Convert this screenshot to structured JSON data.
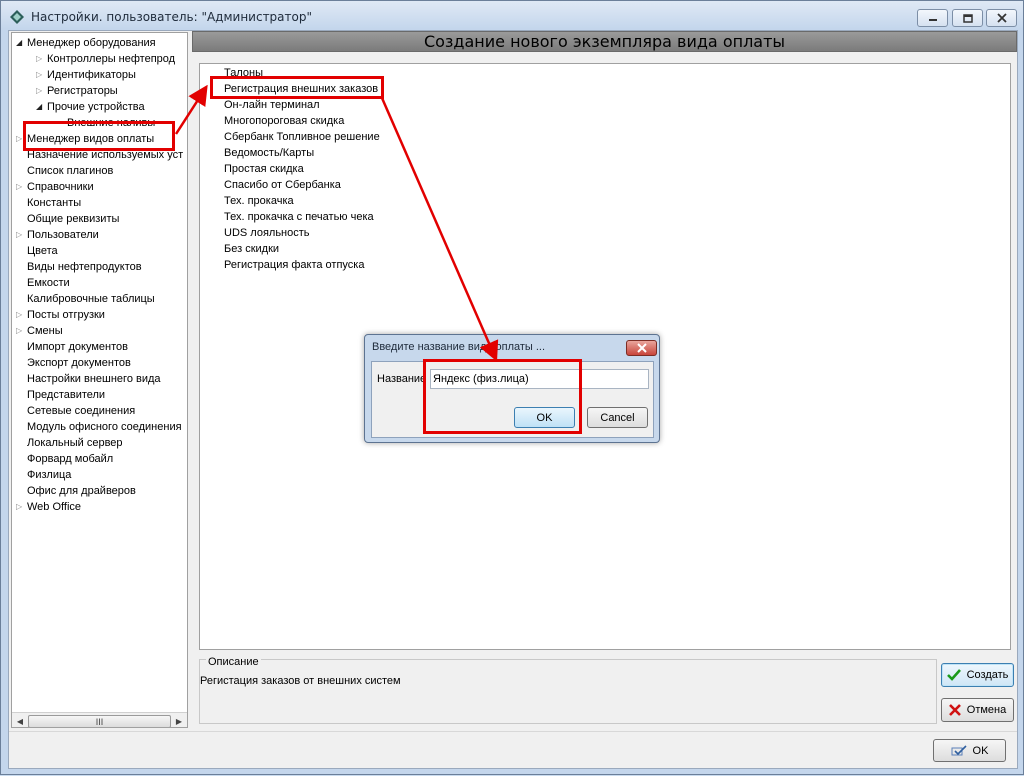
{
  "window": {
    "title": "Настройки. пользователь: \"Администратор\"",
    "accent": "#c4d6ec"
  },
  "tree": {
    "items": [
      {
        "label": "Менеджер оборудования",
        "level": 0,
        "state": "expanded"
      },
      {
        "label": "Контроллеры нефтепрод",
        "level": 1,
        "state": "collapsed"
      },
      {
        "label": "Идентификаторы",
        "level": 1,
        "state": "collapsed"
      },
      {
        "label": "Регистраторы",
        "level": 1,
        "state": "collapsed"
      },
      {
        "label": "Прочие устройства",
        "level": 1,
        "state": "expanded"
      },
      {
        "label": "Внешние наливы",
        "level": 2,
        "state": "leaf"
      },
      {
        "label": "Менеджер видов оплаты",
        "level": 0,
        "state": "collapsed",
        "selected": true
      },
      {
        "label": "Назначение используемых уст",
        "level": 0,
        "state": "leaf"
      },
      {
        "label": "Список плагинов",
        "level": 0,
        "state": "leaf"
      },
      {
        "label": "Справочники",
        "level": 0,
        "state": "collapsed"
      },
      {
        "label": "Константы",
        "level": 0,
        "state": "leaf"
      },
      {
        "label": "Общие реквизиты",
        "level": 0,
        "state": "leaf"
      },
      {
        "label": "Пользователи",
        "level": 0,
        "state": "collapsed"
      },
      {
        "label": "Цвета",
        "level": 0,
        "state": "leaf"
      },
      {
        "label": "Виды нефтепродуктов",
        "level": 0,
        "state": "leaf"
      },
      {
        "label": "Емкости",
        "level": 0,
        "state": "leaf"
      },
      {
        "label": "Калибровочные таблицы",
        "level": 0,
        "state": "leaf"
      },
      {
        "label": "Посты отгрузки",
        "level": 0,
        "state": "collapsed"
      },
      {
        "label": "Смены",
        "level": 0,
        "state": "collapsed"
      },
      {
        "label": "Импорт документов",
        "level": 0,
        "state": "leaf"
      },
      {
        "label": "Экспорт документов",
        "level": 0,
        "state": "leaf"
      },
      {
        "label": "Настройки внешнего вида",
        "level": 0,
        "state": "leaf"
      },
      {
        "label": "Представители",
        "level": 0,
        "state": "leaf"
      },
      {
        "label": "Сетевые соединения",
        "level": 0,
        "state": "leaf"
      },
      {
        "label": "Модуль офисного соединения",
        "level": 0,
        "state": "leaf"
      },
      {
        "label": "Локальный сервер",
        "level": 0,
        "state": "leaf"
      },
      {
        "label": "Форвард мобайл",
        "level": 0,
        "state": "leaf"
      },
      {
        "label": "Физлица",
        "level": 0,
        "state": "leaf"
      },
      {
        "label": "Офис для драйверов",
        "level": 0,
        "state": "leaf"
      },
      {
        "label": "Web Office",
        "level": 0,
        "state": "collapsed"
      }
    ],
    "scroll_grip": "III"
  },
  "main": {
    "header": "Создание нового экземпляра вида оплаты",
    "payment_types": [
      "Талоны",
      "Регистрация внешних заказов",
      "Он-лайн терминал",
      "Многопороговая скидка",
      "Сбербанк Топливное решение",
      "Ведомость/Карты",
      "Простая скидка",
      "Спасибо от Сбербанка",
      "Тех. прокачка",
      "Тех. прокачка с печатью чека",
      "UDS лояльность",
      "Без скидки",
      "Регистрация факта отпуска"
    ],
    "description": {
      "legend": "Описание",
      "text": "Регистация заказов от внешних систем"
    },
    "buttons": {
      "create": "Создать",
      "cancel": "Отмена",
      "ok": "OK"
    }
  },
  "dialog": {
    "title": "Введите название вида оплаты ...",
    "label": "Название",
    "value": "Яндекс (физ.лица)",
    "ok": "OK",
    "cancel": "Cancel"
  },
  "annotation_color": "#e20000"
}
